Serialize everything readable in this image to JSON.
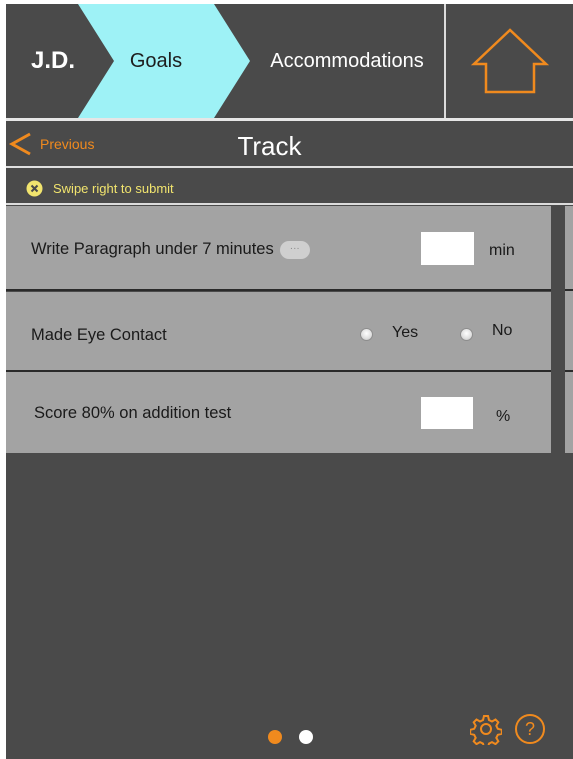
{
  "header": {
    "breadcrumbs": [
      {
        "label": "J.D."
      },
      {
        "label": "Goals"
      },
      {
        "label": "Accommodations"
      }
    ],
    "home_icon": "home-icon"
  },
  "nav": {
    "previous_label": "Previous",
    "title": "Track"
  },
  "hint": {
    "text": "Swipe right to submit",
    "icon": "close-circle-icon"
  },
  "goals": [
    {
      "label": "Write Paragraph under 7 minutes",
      "input_value": "",
      "unit": "min",
      "has_more": true,
      "more_label": "···"
    },
    {
      "label": "Made Eye Contact",
      "options": [
        "Yes",
        "No"
      ],
      "selected": null
    },
    {
      "label": "Score 80% on addition test",
      "input_value": "",
      "unit": "%"
    }
  ],
  "pager": {
    "pages": 2,
    "current": 1
  },
  "footer": {
    "settings_icon": "gear-icon",
    "help_icon": "help-circle-icon",
    "help_glyph": "?"
  },
  "colors": {
    "background": "#4a4a4a",
    "accent": "#f08a1e",
    "active_breadcrumb": "#9ef2f6",
    "card": "#a3a3a3",
    "hint": "#f1e46e"
  }
}
